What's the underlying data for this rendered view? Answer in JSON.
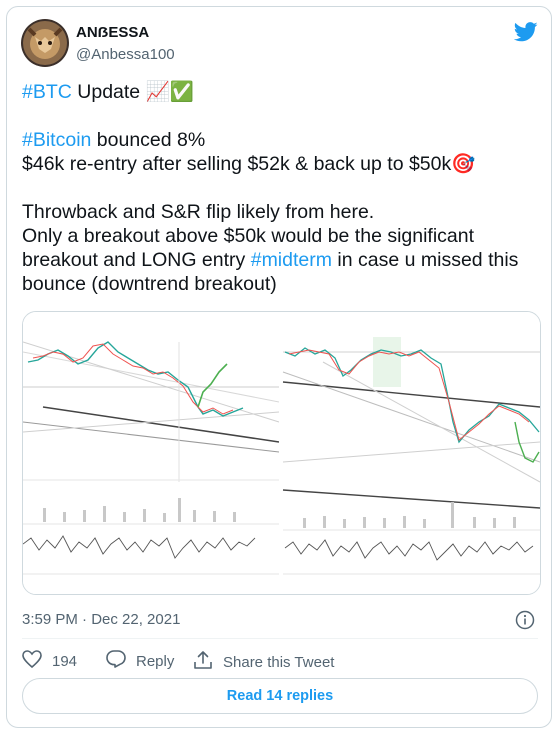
{
  "author": {
    "name": "ANẞESSA",
    "handle": "@Anbessa100"
  },
  "tweet": {
    "line1_hashtag": "#BTC",
    "line1_text": " Update ",
    "line1_emoji": "📈✅",
    "line2_hashtag": "#Bitcoin",
    "line2_text": " bounced 8%",
    "line3_text": "$46k re-entry after selling $52k & back up to $50k",
    "line3_emoji": "🎯",
    "line4_text": "Throwback and S&R flip likely from here.",
    "line5_text": "Only a breakout above $50k would be the significant",
    "line6_text_a": "breakout and LONG entry ",
    "line6_hashtag": "#midterm",
    "line6_text_b": " in case u missed this",
    "line7_text": "bounce (downtrend breakout)"
  },
  "meta": {
    "timestamp": "3:59 PM · Dec 22, 2021"
  },
  "actions": {
    "likes": "194",
    "reply_label": "Reply",
    "share_label": "Share this Tweet"
  },
  "replies_button": "Read 14 replies",
  "icons": {
    "brand": "twitter-bird-icon",
    "info": "info-icon",
    "like": "heart-icon",
    "reply": "reply-icon",
    "share": "share-icon"
  },
  "colors": {
    "accent": "#1d9bf0",
    "text": "#0f1419",
    "secondary": "#536471",
    "border": "#cfd9de"
  }
}
